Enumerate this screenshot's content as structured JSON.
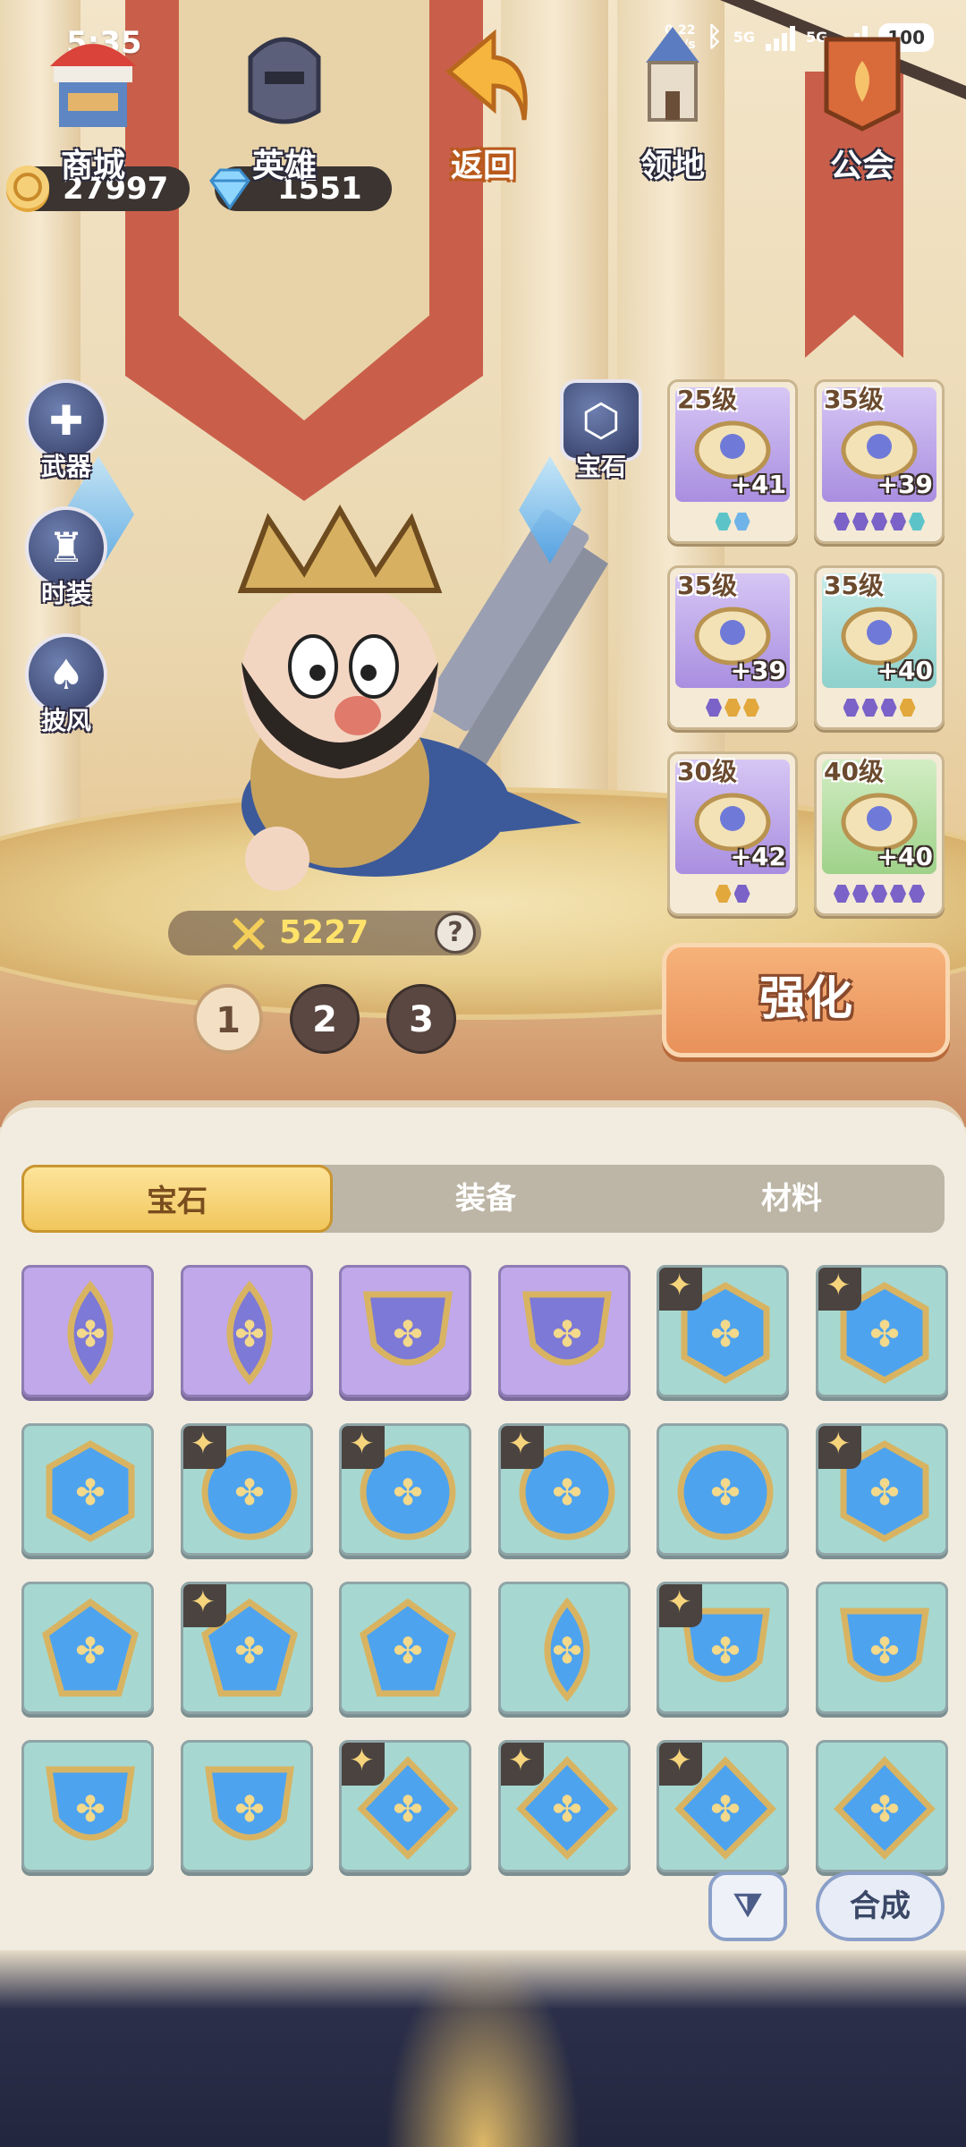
{
  "status_bar": {
    "time": "5:35",
    "net_speed": "0.22",
    "net_unit": "KB/s",
    "sim1": "5G",
    "sim2": "5G",
    "battery": "100"
  },
  "currency": {
    "gold": "27997",
    "gems": "1551"
  },
  "side_menu": {
    "weapon": "武器",
    "costume": "时装",
    "cape": "披风",
    "gem_slot": "宝石"
  },
  "equipment": [
    {
      "level": "25级",
      "bonus": "+41",
      "slots": [
        "teal",
        "blue"
      ],
      "color": "purple",
      "icon": "crown-icon"
    },
    {
      "level": "35级",
      "bonus": "+39",
      "slots": [
        "purple",
        "purple",
        "purple",
        "purple",
        "teal"
      ],
      "color": "purple",
      "icon": "amulet-icon"
    },
    {
      "level": "35级",
      "bonus": "+39",
      "slots": [
        "purple",
        "gold",
        "gold"
      ],
      "color": "purple",
      "icon": "armor-icon"
    },
    {
      "level": "35级",
      "bonus": "+40",
      "slots": [
        "purple",
        "purple",
        "purple",
        "gold"
      ],
      "color": "teal",
      "icon": "glove-icon"
    },
    {
      "level": "30级",
      "bonus": "+42",
      "slots": [
        "gold",
        "purple"
      ],
      "color": "purple",
      "icon": "boots-icon"
    },
    {
      "level": "40级",
      "bonus": "+40",
      "slots": [
        "purple",
        "purple",
        "purple",
        "purple",
        "purple"
      ],
      "color": "green",
      "icon": "ring-icon"
    }
  ],
  "power": {
    "value": "5227",
    "help": "?"
  },
  "pages": [
    "1",
    "2",
    "3"
  ],
  "upgrade_label": "强化",
  "tabs": [
    "宝石",
    "装备",
    "材料"
  ],
  "inventory": [
    {
      "shape": "drop",
      "color": "purple",
      "star": false
    },
    {
      "shape": "drop",
      "color": "purple",
      "star": false
    },
    {
      "shape": "shield",
      "color": "purple",
      "star": false
    },
    {
      "shape": "shield",
      "color": "purple",
      "star": false
    },
    {
      "shape": "hex",
      "color": "teal",
      "star": true
    },
    {
      "shape": "hex",
      "color": "teal",
      "star": true
    },
    {
      "shape": "hex",
      "color": "teal",
      "star": false
    },
    {
      "shape": "circle",
      "color": "teal",
      "star": true
    },
    {
      "shape": "circle",
      "color": "teal",
      "star": true
    },
    {
      "shape": "circle",
      "color": "teal",
      "star": true
    },
    {
      "shape": "circle",
      "color": "teal",
      "star": false
    },
    {
      "shape": "hex",
      "color": "teal",
      "star": true
    },
    {
      "shape": "pentagon",
      "color": "teal",
      "star": false
    },
    {
      "shape": "pentagon",
      "color": "teal",
      "star": true
    },
    {
      "shape": "pentagon",
      "color": "teal",
      "star": false
    },
    {
      "shape": "drop",
      "color": "teal",
      "star": false
    },
    {
      "shape": "shield",
      "color": "teal",
      "star": true
    },
    {
      "shape": "shield",
      "color": "teal",
      "star": false
    },
    {
      "shape": "shield",
      "color": "teal",
      "star": false
    },
    {
      "shape": "shield",
      "color": "teal",
      "star": false
    },
    {
      "shape": "diamond",
      "color": "teal",
      "star": true
    },
    {
      "shape": "diamond",
      "color": "teal",
      "star": true
    },
    {
      "shape": "diamond",
      "color": "teal",
      "star": true
    },
    {
      "shape": "diamond",
      "color": "teal",
      "star": false
    }
  ],
  "merge_label": "合成",
  "filter_icon": "filter-sort-icon",
  "nav": {
    "shop": "商城",
    "heroes": "英雄",
    "back": "返回",
    "territory": "领地",
    "guild": "公会"
  },
  "colors": {
    "gold_button": "#f1c65c",
    "upgrade_button": "#e9915a",
    "teal_gem": "#a6d8d1",
    "purple_gem": "#c0a8ea",
    "nav_bg": "#22263e"
  }
}
